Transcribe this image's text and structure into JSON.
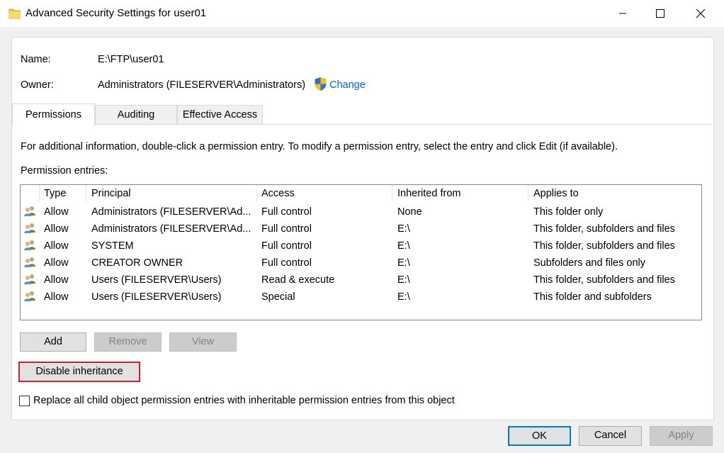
{
  "window": {
    "title": "Advanced Security Settings for user01",
    "icon": "folder-icon",
    "controls": [
      "minimize-icon",
      "maximize-icon",
      "close-icon"
    ]
  },
  "object": {
    "name_label": "Name:",
    "name_value": "E:\\FTP\\user01",
    "owner_label": "Owner:",
    "owner_value": "Administrators (FILESERVER\\Administrators)",
    "change_label": "Change",
    "link_color": "#0066cc"
  },
  "tabs": [
    {
      "label": "Permissions",
      "active": true
    },
    {
      "label": "Auditing",
      "active": false
    },
    {
      "label": "Effective Access",
      "active": false
    }
  ],
  "permissions": {
    "info_text": "For additional information, double-click a permission entry. To modify a permission entry, select the entry and click Edit (if available).",
    "entries_label": "Permission entries:",
    "columns": [
      "Type",
      "Principal",
      "Access",
      "Inherited from",
      "Applies to"
    ],
    "rows": [
      {
        "type": "Allow",
        "principal": "Administrators (FILESERVER\\Ad...",
        "access": "Full control",
        "inherited": "None",
        "applies": "This folder only"
      },
      {
        "type": "Allow",
        "principal": "Administrators (FILESERVER\\Ad...",
        "access": "Full control",
        "inherited": "E:\\",
        "applies": "This folder, subfolders and files"
      },
      {
        "type": "Allow",
        "principal": "SYSTEM",
        "access": "Full control",
        "inherited": "E:\\",
        "applies": "This folder, subfolders and files"
      },
      {
        "type": "Allow",
        "principal": "CREATOR OWNER",
        "access": "Full control",
        "inherited": "E:\\",
        "applies": "Subfolders and files only"
      },
      {
        "type": "Allow",
        "principal": "Users (FILESERVER\\Users)",
        "access": "Read & execute",
        "inherited": "E:\\",
        "applies": "This folder, subfolders and files"
      },
      {
        "type": "Allow",
        "principal": "Users (FILESERVER\\Users)",
        "access": "Special",
        "inherited": "E:\\",
        "applies": "This folder and subfolders"
      }
    ],
    "add_label": "Add",
    "remove_label": "Remove",
    "view_label": "View",
    "disable_inheritance_label": "Disable inheritance",
    "replace_label": "Replace all child object permission entries with inheritable permission entries from this object",
    "replace_checked": false
  },
  "footer": {
    "ok_label": "OK",
    "cancel_label": "Cancel",
    "apply_label": "Apply"
  },
  "colors": {
    "highlight_border": "#d0202f",
    "default_button_border": "#0078d7"
  }
}
